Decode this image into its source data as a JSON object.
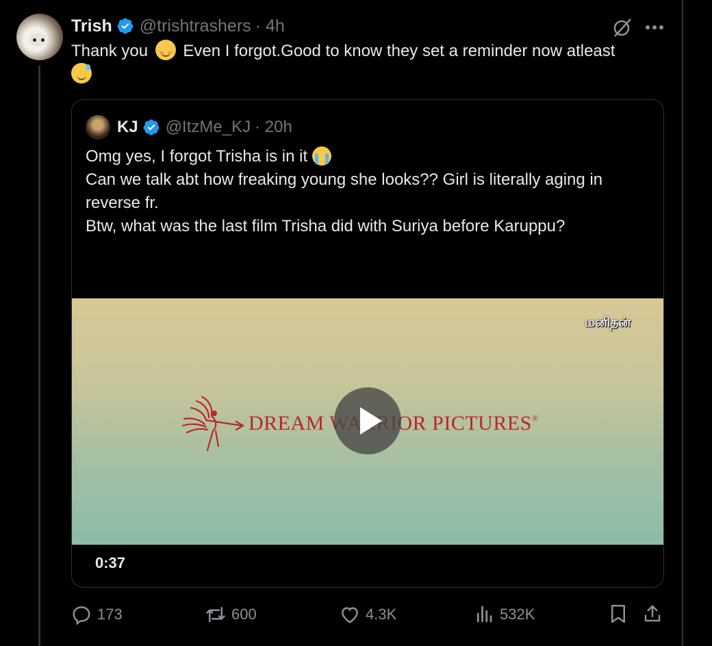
{
  "tweet": {
    "author_name": "Trish",
    "author_handle": "@trishtrashers",
    "time": "· 4h",
    "text_part1": "Thank you",
    "text_part2": "Even I forgot.Good to know they set a reminder now atleast"
  },
  "quote": {
    "author_name": "KJ",
    "author_handle": "@ItzMe_KJ",
    "time": "· 20h",
    "lines": [
      "Omg yes, I forgot Trisha is in it",
      "Can we talk abt how freaking young she looks?? Girl is literally aging in",
      "reverse fr.",
      "Btw, what was the last film Trisha did with Suriya before Karuppu?"
    ],
    "video": {
      "brand_text": "DREAM WARRIOR PICTURES",
      "brand_mark": "®",
      "duration": "0:37"
    }
  },
  "watermark": "மனிதன்",
  "actions": {
    "replies": "173",
    "reposts": "600",
    "likes": "4.3K",
    "views": "532K"
  },
  "icons": {
    "verified": "verified-badge-icon",
    "grok": "grok-icon",
    "more": "more-icon",
    "reply": "reply-icon",
    "repost": "repost-icon",
    "like": "heart-icon",
    "views": "views-icon",
    "bookmark": "bookmark-icon",
    "share": "share-icon",
    "play": "play-icon"
  },
  "colors": {
    "background": "#000000",
    "text": "#e7e9ea",
    "muted": "#71767b",
    "verified": "#1d9bf0",
    "brand": "#b8262e"
  }
}
